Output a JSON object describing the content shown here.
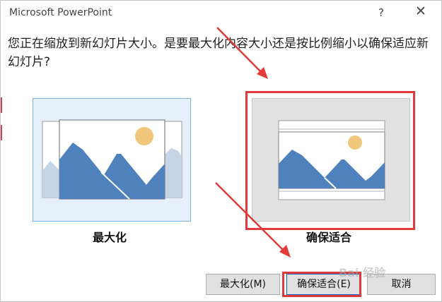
{
  "window": {
    "title": "Microsoft PowerPoint",
    "help_glyph": "?",
    "close_glyph": "✕"
  },
  "question": "您正在缩放到新幻灯片大小。是要最大化内容大小还是按比例缩小以确保适应新幻灯片?",
  "options": {
    "maximize_label": "最大化",
    "ensure_fit_label": "确保适合"
  },
  "buttons": {
    "maximize": "最大化(M)",
    "ensure_fit": "确保适合(E)",
    "cancel": "取消"
  },
  "watermark": "Bai 经验",
  "colors": {
    "annotation_red": "#e23a3a",
    "selected_card_border": "#7ab4e2",
    "selected_card_bg": "#e5f0fb",
    "mountain_blue": "#4f81bd",
    "sun_yellow": "#f0c77a"
  },
  "icons": {
    "help": "question-mark-icon",
    "close": "close-icon"
  }
}
